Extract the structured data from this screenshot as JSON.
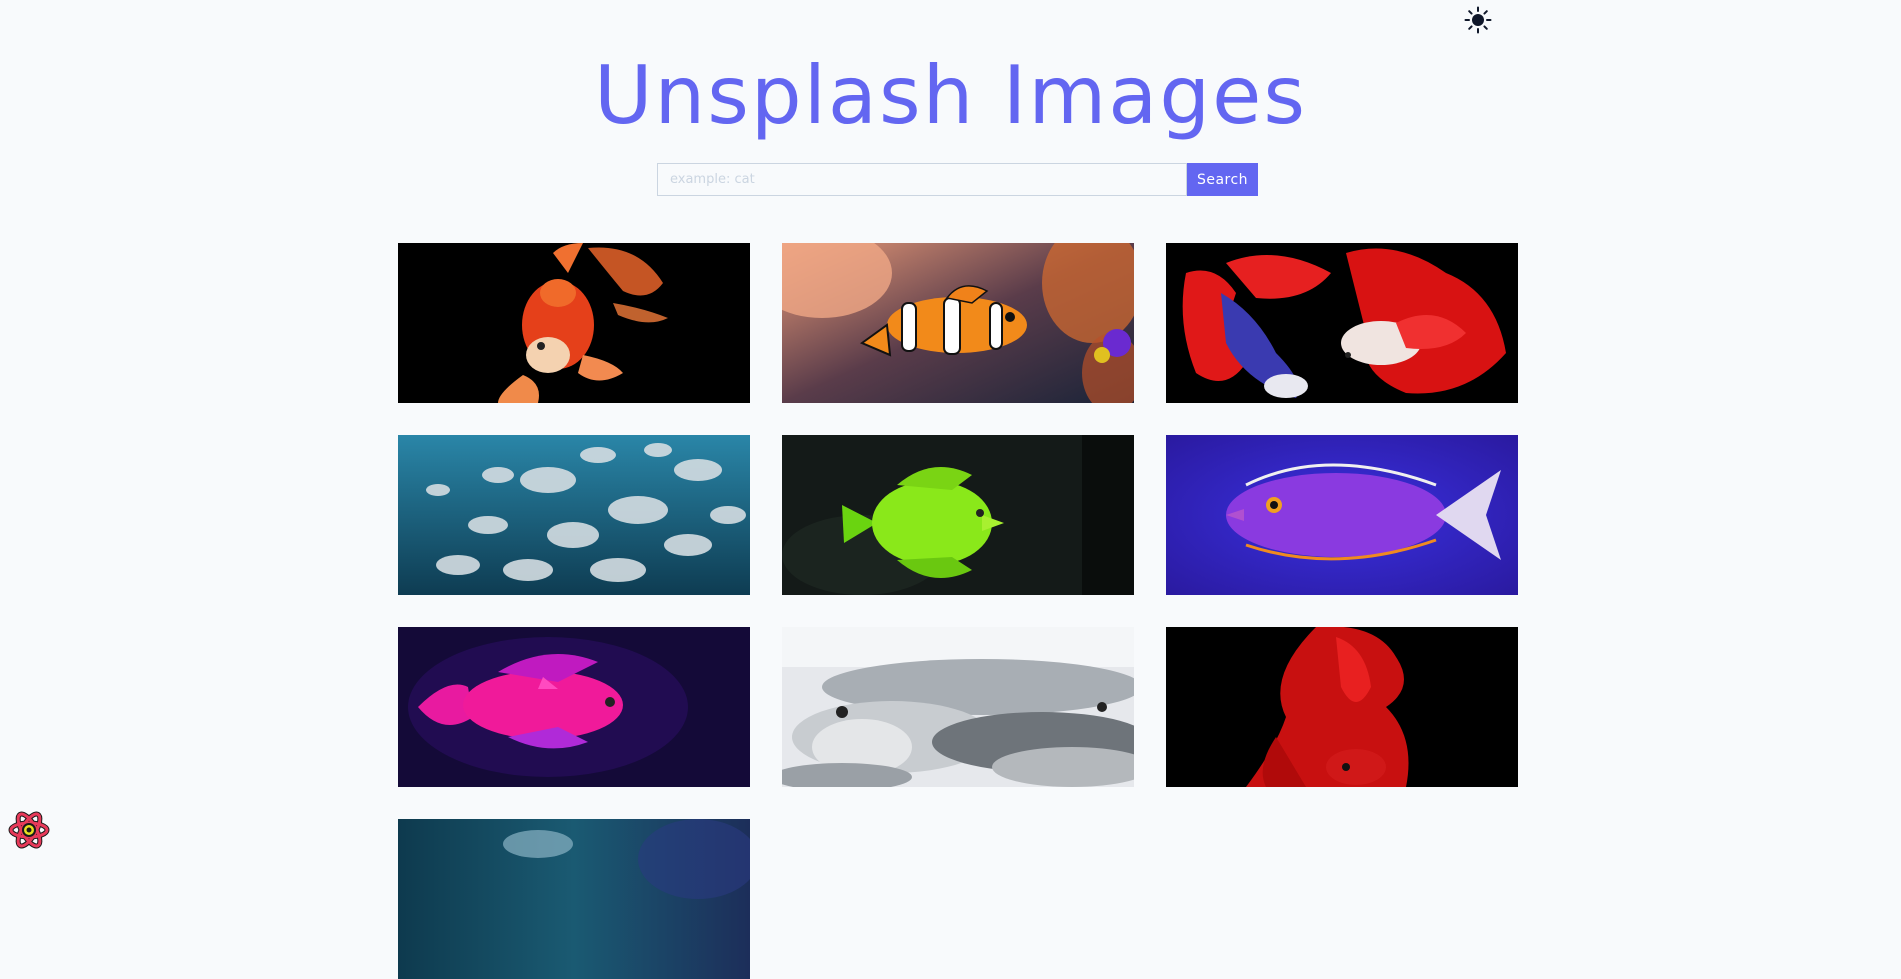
{
  "header": {
    "title": "Unsplash Images",
    "theme_icon": "sun-icon"
  },
  "search": {
    "placeholder": "example: cat",
    "value": "",
    "button_label": "Search"
  },
  "colors": {
    "accent": "#6366f1",
    "background": "#f8fafc",
    "input_border": "#cbd5e1",
    "icon_dark": "#0f172a"
  },
  "gallery": {
    "images": [
      {
        "subject": "goldfish-black-bg"
      },
      {
        "subject": "clownfish-reef"
      },
      {
        "subject": "betta-pair-red"
      },
      {
        "subject": "fish-school-underwater"
      },
      {
        "subject": "yellow-tang"
      },
      {
        "subject": "purple-tang"
      },
      {
        "subject": "pink-anthias"
      },
      {
        "subject": "fish-market-pile"
      },
      {
        "subject": "red-betta-tail"
      },
      {
        "subject": "underwater-blue-partial"
      }
    ]
  },
  "devtools": {
    "icon": "react-logo-icon"
  }
}
